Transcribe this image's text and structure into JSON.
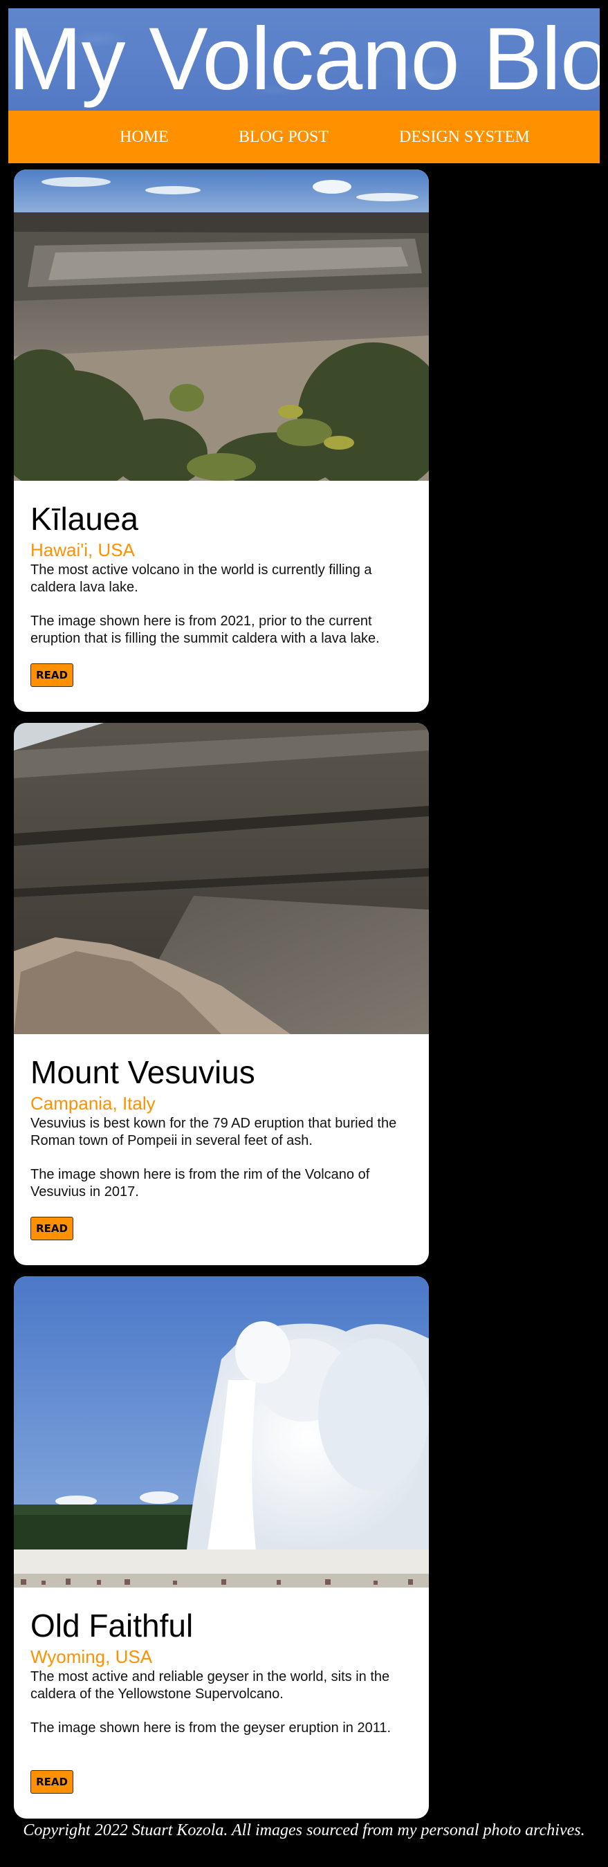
{
  "site": {
    "title": "My Volcano Blog"
  },
  "nav": {
    "items": [
      {
        "label": "HOME"
      },
      {
        "label": "BLOG POST"
      },
      {
        "label": "DESIGN SYSTEM"
      }
    ]
  },
  "posts": [
    {
      "title": "Kīlauea",
      "location": "Hawai'i, USA",
      "description": "The most active volcano in the world is currently filling a caldera lava lake.",
      "note": "The image shown here is from 2021, prior to the current eruption that is filling the summit caldera with a lava lake.",
      "button_label": "READ"
    },
    {
      "title": "Mount Vesuvius",
      "location": "Campania, Italy",
      "description": "Vesuvius is best kown for the 79 AD eruption that buried the Roman town of Pompeii in several feet of ash.",
      "note": "The image shown here is from the rim of the Volcano of Vesuvius in 2017.",
      "button_label": "READ"
    },
    {
      "title": "Old Faithful",
      "location": "Wyoming, USA",
      "description": "The most active and reliable geyser in the world, sits in the caldera of the Yellowstone Supervolcano.",
      "note": "The image shown here is from the geyser eruption in 2011.",
      "button_label": "READ"
    }
  ],
  "footer": {
    "text": "Copyright 2022 Stuart Kozola. All images sourced from my personal photo archives."
  },
  "colors": {
    "page_background": "#000000",
    "header_blue": "#5a81c9",
    "accent_orange": "#ff9100",
    "card_background": "#ffffff"
  }
}
